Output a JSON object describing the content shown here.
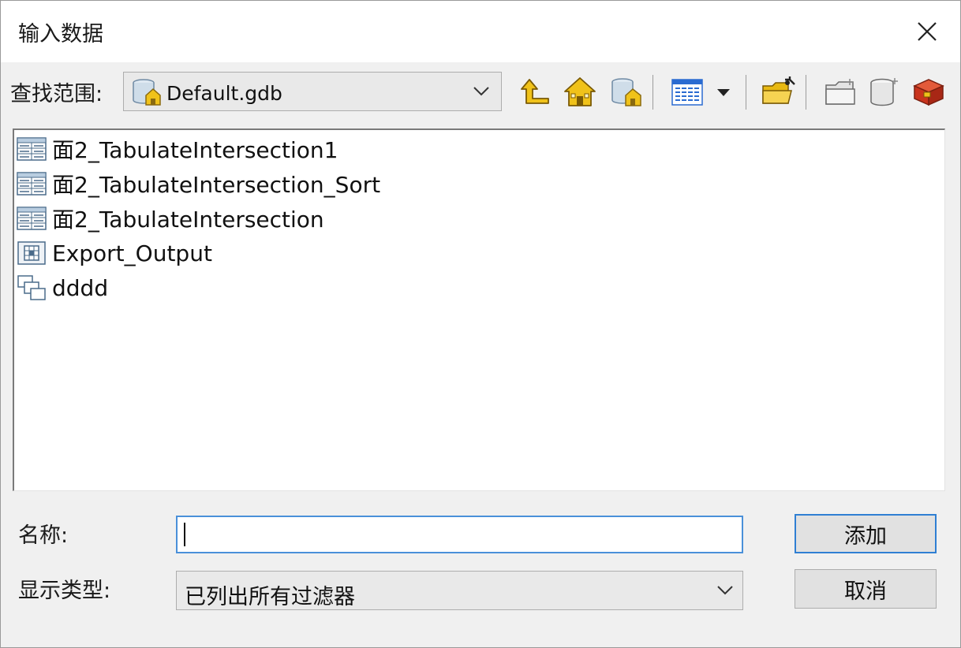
{
  "dialog": {
    "title": "输入数据"
  },
  "look_in": {
    "label": "查找范围:",
    "value": "Default.gdb"
  },
  "toolbar": {
    "icons": [
      "up-one-level-icon",
      "home-icon",
      "database-connection-icon",
      "view-menu-icon",
      "view-dropdown-icon",
      "connect-folder-icon",
      "new-folder-icon",
      "new-database-icon",
      "toolbox-icon"
    ]
  },
  "file_list": {
    "items": [
      {
        "label": "面2_TabulateIntersection1",
        "icon": "table-icon"
      },
      {
        "label": "面2_TabulateIntersection_Sort",
        "icon": "table-icon"
      },
      {
        "label": "面2_TabulateIntersection",
        "icon": "table-icon"
      },
      {
        "label": "Export_Output",
        "icon": "raster-icon"
      },
      {
        "label": "dddd",
        "icon": "feature-dataset-icon"
      }
    ]
  },
  "name_field": {
    "label": "名称:",
    "value": ""
  },
  "show_type": {
    "label": "显示类型:",
    "value": "已列出所有过滤器"
  },
  "buttons": {
    "add": "添加",
    "cancel": "取消"
  },
  "colors": {
    "dialog_bg": "#f0f0f0",
    "input_focus_border": "#4a90d9",
    "default_button_border": "#2f7fd3",
    "folder_yellow": "#f0c21a"
  }
}
